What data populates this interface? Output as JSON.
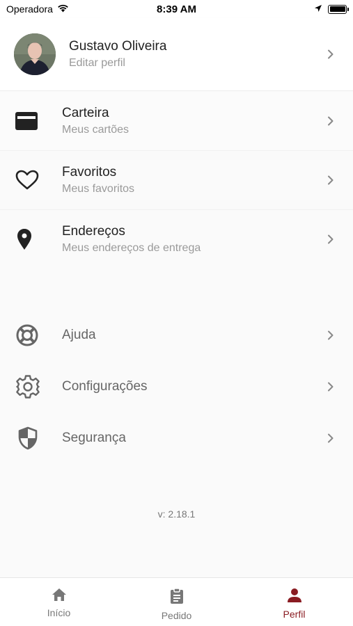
{
  "status_bar": {
    "carrier": "Operadora",
    "time": "8:39 AM"
  },
  "profile": {
    "name": "Gustavo Oliveira",
    "subtitle": "Editar perfil"
  },
  "menu": {
    "wallet": {
      "title": "Carteira",
      "subtitle": "Meus cartões",
      "icon": "credit-card-icon"
    },
    "favorites": {
      "title": "Favoritos",
      "subtitle": "Meus favoritos",
      "icon": "heart-icon"
    },
    "addresses": {
      "title": "Endereços",
      "subtitle": "Meus endereços de entrega",
      "icon": "map-pin-icon"
    },
    "help": {
      "title": "Ajuda",
      "icon": "lifebuoy-icon"
    },
    "settings": {
      "title": "Configurações",
      "icon": "gear-icon"
    },
    "security": {
      "title": "Segurança",
      "icon": "shield-icon"
    }
  },
  "version": "v: 2.18.1",
  "tabs": {
    "home": {
      "label": "Início",
      "icon": "home-icon"
    },
    "orders": {
      "label": "Pedido",
      "icon": "clipboard-icon"
    },
    "profile": {
      "label": "Perfil",
      "icon": "person-icon"
    }
  },
  "colors": {
    "accent": "#8a1c22",
    "icon_dark": "#222222",
    "icon_gray": "#666666",
    "inactive_tab": "#777777"
  }
}
